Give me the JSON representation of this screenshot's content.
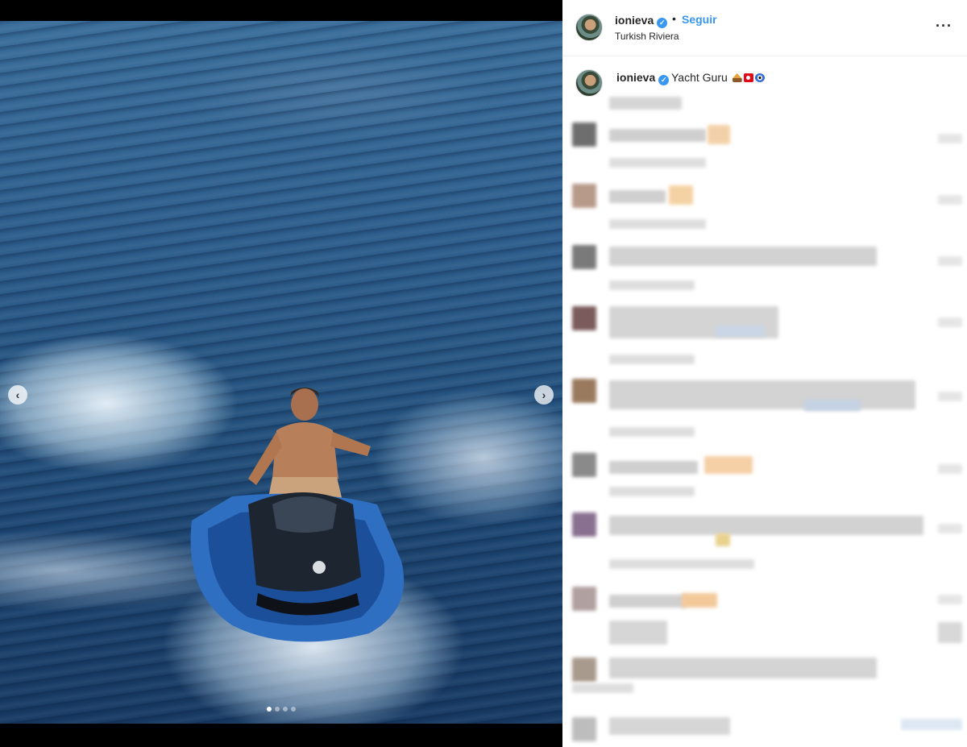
{
  "media": {
    "prev_arrow": "‹",
    "next_arrow": "›",
    "carousel_total": 4,
    "carousel_active": 1
  },
  "post": {
    "username": "ionieva",
    "verified_mark": "✓",
    "separator": "•",
    "follow_label": "Seguir",
    "location": "Turkish Riviera",
    "more_label": "···"
  },
  "caption": {
    "username": "ionieva",
    "verified_mark": "✓",
    "text": "Yacht Guru",
    "emojis": [
      "sailboat-icon",
      "turkey-flag-icon",
      "nazar-icon"
    ]
  },
  "colors": {
    "accent": "#3897f0",
    "text": "#262626",
    "sea": "#2d5d8c"
  }
}
